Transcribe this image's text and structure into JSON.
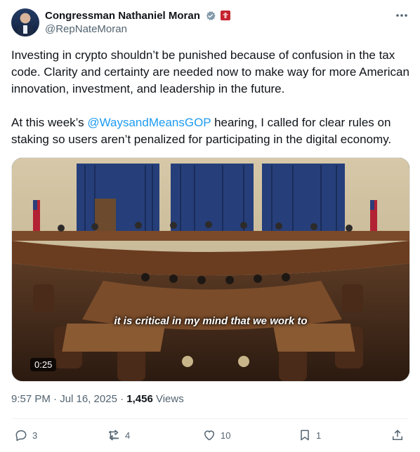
{
  "author": {
    "name": "Congressman Nathaniel Moran",
    "handle": "@RepNateMoran",
    "avatar_icon": "profile-photo"
  },
  "post": {
    "paragraph1": "Investing in crypto shouldn’t be punished because of confusion in the tax code. Clarity and certainty are needed now to make way for more American innovation, investment, and leadership in the future.",
    "paragraph2_before": "At this week’s ",
    "mention": "@WaysandMeansGOP",
    "paragraph2_after": " hearing, I called for clear rules on staking so users aren’t penalized for participating in the digital economy."
  },
  "video": {
    "caption": "it is critical in my mind that we work to",
    "duration": "0:25"
  },
  "meta": {
    "time": "9:57 PM · Jul 16, 2025 · ",
    "views_count": "1,456",
    "views_label": "Views"
  },
  "actions": {
    "replies": "3",
    "reposts": "4",
    "likes": "10",
    "bookmarks": "1"
  },
  "colors": {
    "accent": "#1d9bf0",
    "secondary_text": "#536471",
    "verified": "#829aab",
    "badge": "#c4232f"
  }
}
